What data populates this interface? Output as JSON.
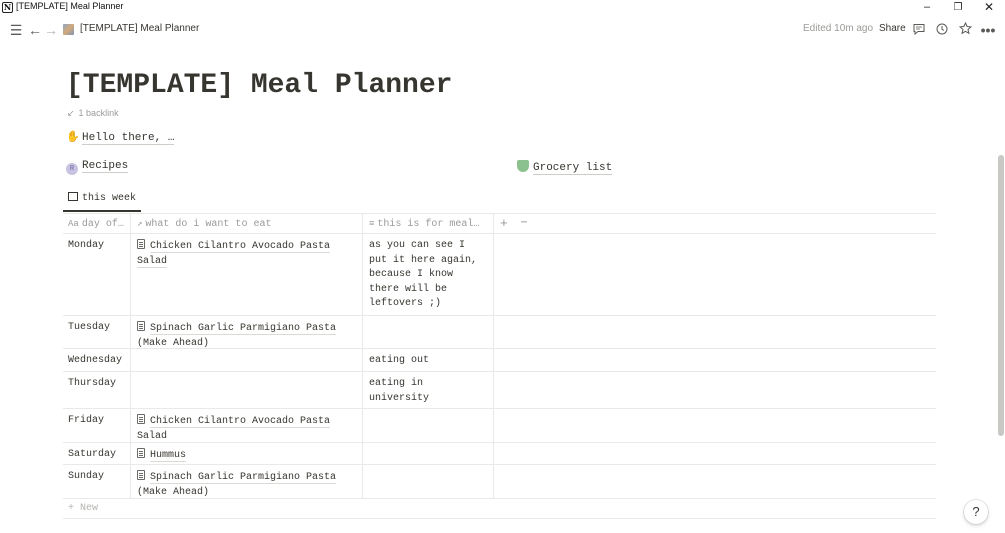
{
  "window": {
    "title": "[TEMPLATE] Meal Planner",
    "app_icon_letter": "N",
    "minimize": "–",
    "maximize": "❐",
    "close": "✕"
  },
  "topbar": {
    "menu_icon": "menu-icon",
    "back_icon": "arrow-left-icon",
    "forward_icon": "arrow-right-icon",
    "breadcrumb": "[TEMPLATE] Meal Planner",
    "edited": "Edited 10m ago",
    "share_label": "Share",
    "comment_icon": "comment-icon",
    "updates_icon": "clock-icon",
    "favorite_icon": "star-icon",
    "more_icon": "more-icon"
  },
  "page": {
    "title": "[TEMPLATE] Meal Planner",
    "backlinks": "1 backlink",
    "hello_text": "Hello there, …",
    "links": [
      {
        "label": "Recipes",
        "icon": "recipes-icon"
      },
      {
        "label": "Grocery list",
        "icon": "basket-icon"
      }
    ]
  },
  "view": {
    "tab_label": "this week",
    "tab_icon": "table-icon"
  },
  "table": {
    "columns": [
      {
        "label": "day of…",
        "icon_glyph": "Aa"
      },
      {
        "label": "what do i want to eat",
        "icon_glyph": "↗"
      },
      {
        "label": "this is for meal…",
        "icon_glyph": "≡"
      }
    ],
    "add_column": "+",
    "more_columns": "⋯",
    "rows": [
      {
        "day": "Monday",
        "meal": "Chicken Cilantro Avocado Pasta Salad",
        "note": "as you can see I put it here again, because I know there will be leftovers ;)"
      },
      {
        "day": "Tuesday",
        "meal": "Spinach Garlic Parmigiano Pasta (Make Ahead)",
        "note": ""
      },
      {
        "day": "Wednesday",
        "meal": "",
        "note": "eating out"
      },
      {
        "day": "Thursday",
        "meal": "",
        "note": "eating in university"
      },
      {
        "day": "Friday",
        "meal": "Chicken Cilantro Avocado Pasta Salad",
        "note": ""
      },
      {
        "day": "Saturday",
        "meal": "Hummus",
        "note": ""
      },
      {
        "day": "Sunday",
        "meal": "Spinach Garlic Parmigiano Pasta (Make Ahead)",
        "note": ""
      }
    ],
    "new_label": "+ New"
  },
  "help_label": "?"
}
